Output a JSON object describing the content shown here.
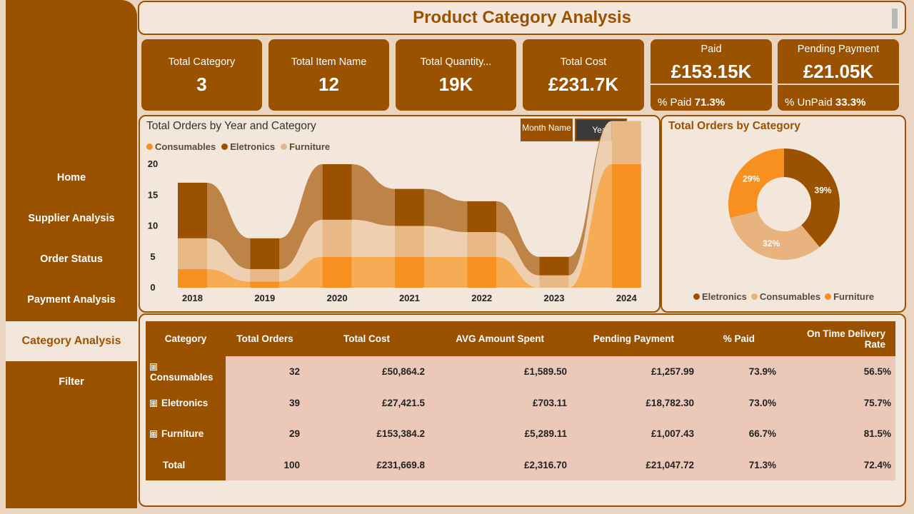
{
  "title": "Product Category Analysis",
  "nav": {
    "items": [
      {
        "label": "Home"
      },
      {
        "label": "Supplier Analysis"
      },
      {
        "label": "Order Status"
      },
      {
        "label": "Payment Analysis"
      },
      {
        "label": "Category Analysis",
        "active": true
      },
      {
        "label": "Filter"
      }
    ]
  },
  "kpis": [
    {
      "label": "Total Category",
      "value": "3"
    },
    {
      "label": "Total Item Name",
      "value": "12"
    },
    {
      "label": "Total Quantity...",
      "value": "19K"
    },
    {
      "label": "Total Cost",
      "value": "£231.7K"
    }
  ],
  "kpis2": [
    {
      "label": "Paid",
      "value": "£153.15K",
      "sub_label": "% Paid",
      "sub_value": "71.3%"
    },
    {
      "label": "Pending Payment",
      "value": "£21.05K",
      "sub_label": "% UnPaid",
      "sub_value": "33.3%"
    }
  ],
  "orders_chart": {
    "title": "Total Orders by Year and Category",
    "toggle_month": "Month Name",
    "toggle_year": "Year",
    "legend": [
      {
        "name": "Consumables",
        "color": "#f7901e"
      },
      {
        "name": "Eletronics",
        "color": "#9a5200"
      },
      {
        "name": "Furniture",
        "color": "#e8b986"
      }
    ]
  },
  "donut_chart": {
    "title": "Total Orders by Category",
    "legend": [
      {
        "name": "Eletronics",
        "color": "#9a5200"
      },
      {
        "name": "Consumables",
        "color": "#e8b37e"
      },
      {
        "name": "Furniture",
        "color": "#f7901e"
      }
    ]
  },
  "chart_data": [
    {
      "type": "bar",
      "title": "Total Orders by Year and Category",
      "categories": [
        "2018",
        "2019",
        "2020",
        "2021",
        "2022",
        "2023",
        "2024"
      ],
      "series": [
        {
          "name": "Consumables",
          "values": [
            3,
            1,
            5,
            5,
            5,
            0,
            20
          ]
        },
        {
          "name": "Furniture",
          "values": [
            5,
            2,
            6,
            5,
            4,
            2,
            7
          ]
        },
        {
          "name": "Eletronics",
          "values": [
            9,
            5,
            9,
            6,
            5,
            3,
            0
          ]
        }
      ],
      "stacked": true,
      "ylim": [
        0,
        20
      ],
      "yticks": [
        0,
        5,
        10,
        15,
        20
      ],
      "legend": "top-left"
    },
    {
      "type": "pie",
      "title": "Total Orders by Category",
      "donut": true,
      "slices": [
        {
          "name": "Eletronics",
          "value": 39,
          "label": "39%"
        },
        {
          "name": "Consumables",
          "value": 32,
          "label": "32%"
        },
        {
          "name": "Furniture",
          "value": 29,
          "label": "29%"
        }
      ],
      "legend": "bottom"
    }
  ],
  "table": {
    "headers": [
      "Category",
      "Total Orders",
      "Total Cost",
      "AVG Amount Spent",
      "Pending Payment",
      "% Paid",
      "On Time Delivery Rate"
    ],
    "rows": [
      {
        "expand": "⊞",
        "cells": [
          "Consumables",
          "32",
          "£50,864.2",
          "£1,589.50",
          "£1,257.99",
          "73.9%",
          "56.5%"
        ]
      },
      {
        "expand": "⊞",
        "cells": [
          "Eletronics",
          "39",
          "£27,421.5",
          "£703.11",
          "£18,782.30",
          "73.0%",
          "75.7%"
        ]
      },
      {
        "expand": "⊞",
        "cells": [
          "Furniture",
          "29",
          "£153,384.2",
          "£5,289.11",
          "£1,007.43",
          "66.7%",
          "81.5%"
        ]
      },
      {
        "expand": "",
        "cells": [
          "Total",
          "100",
          "£231,669.8",
          "£2,316.70",
          "£21,047.72",
          "71.3%",
          "72.4%"
        ]
      }
    ]
  }
}
